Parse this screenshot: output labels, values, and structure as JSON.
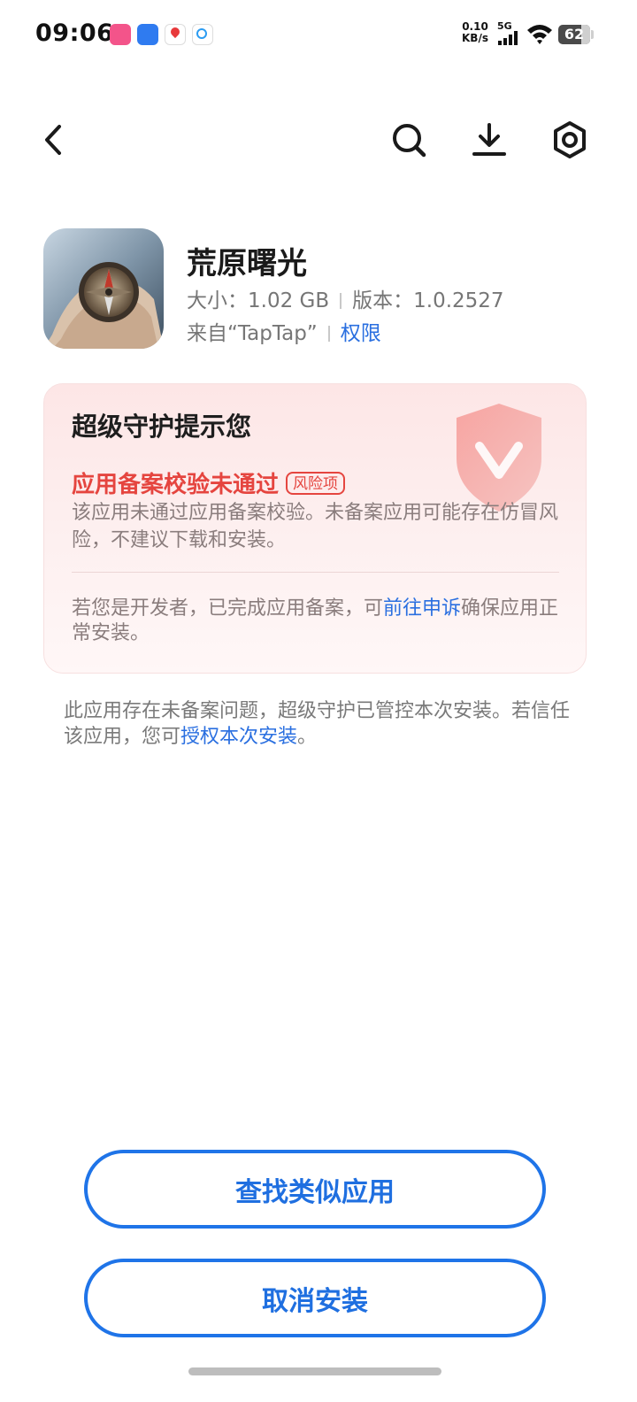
{
  "status_bar": {
    "time": "09:06",
    "net_speed_value": "0.10",
    "net_speed_unit": "KB/s",
    "network_type": "5G",
    "battery_level": "62",
    "notification_icons": [
      "bilibili-icon",
      "browser-icon",
      "map-icon",
      "search-app-icon"
    ]
  },
  "nav": {
    "back_icon": "chevron-left-icon",
    "search_icon": "search-icon",
    "download_icon": "download-icon",
    "settings_icon": "settings-icon"
  },
  "app": {
    "name": "荒原曙光",
    "size": "大小：1.02 GB",
    "version": "版本：1.0.2527",
    "source": "来自“TapTap”",
    "permissions_link": "权限"
  },
  "warning_card": {
    "title": "超级守护提示您",
    "risk_title": "应用备案校验未通过",
    "risk_badge": "风险项",
    "risk_description": "该应用未通过应用备案校验。未备案应用可能存在仿冒风险，不建议下载和安装。",
    "developer_note_prefix": "若您是开发者，已完成应用备案，可",
    "developer_note_link": "前往申诉",
    "developer_note_suffix": "确保应用正常安装。",
    "shield_icon": "shield-v-icon"
  },
  "guard_note": {
    "text_prefix": "此应用存在未备案问题，超级守护已管控本次安装。若信任该应用，您可",
    "link": "授权本次安装",
    "text_suffix": "。"
  },
  "buttons": {
    "find_similar": "查找类似应用",
    "cancel_install": "取消安装"
  },
  "colors": {
    "accent": "#1f74e8",
    "link": "#2a6fe0",
    "risk": "#e5453f",
    "card_bg": "#fde6e6"
  }
}
